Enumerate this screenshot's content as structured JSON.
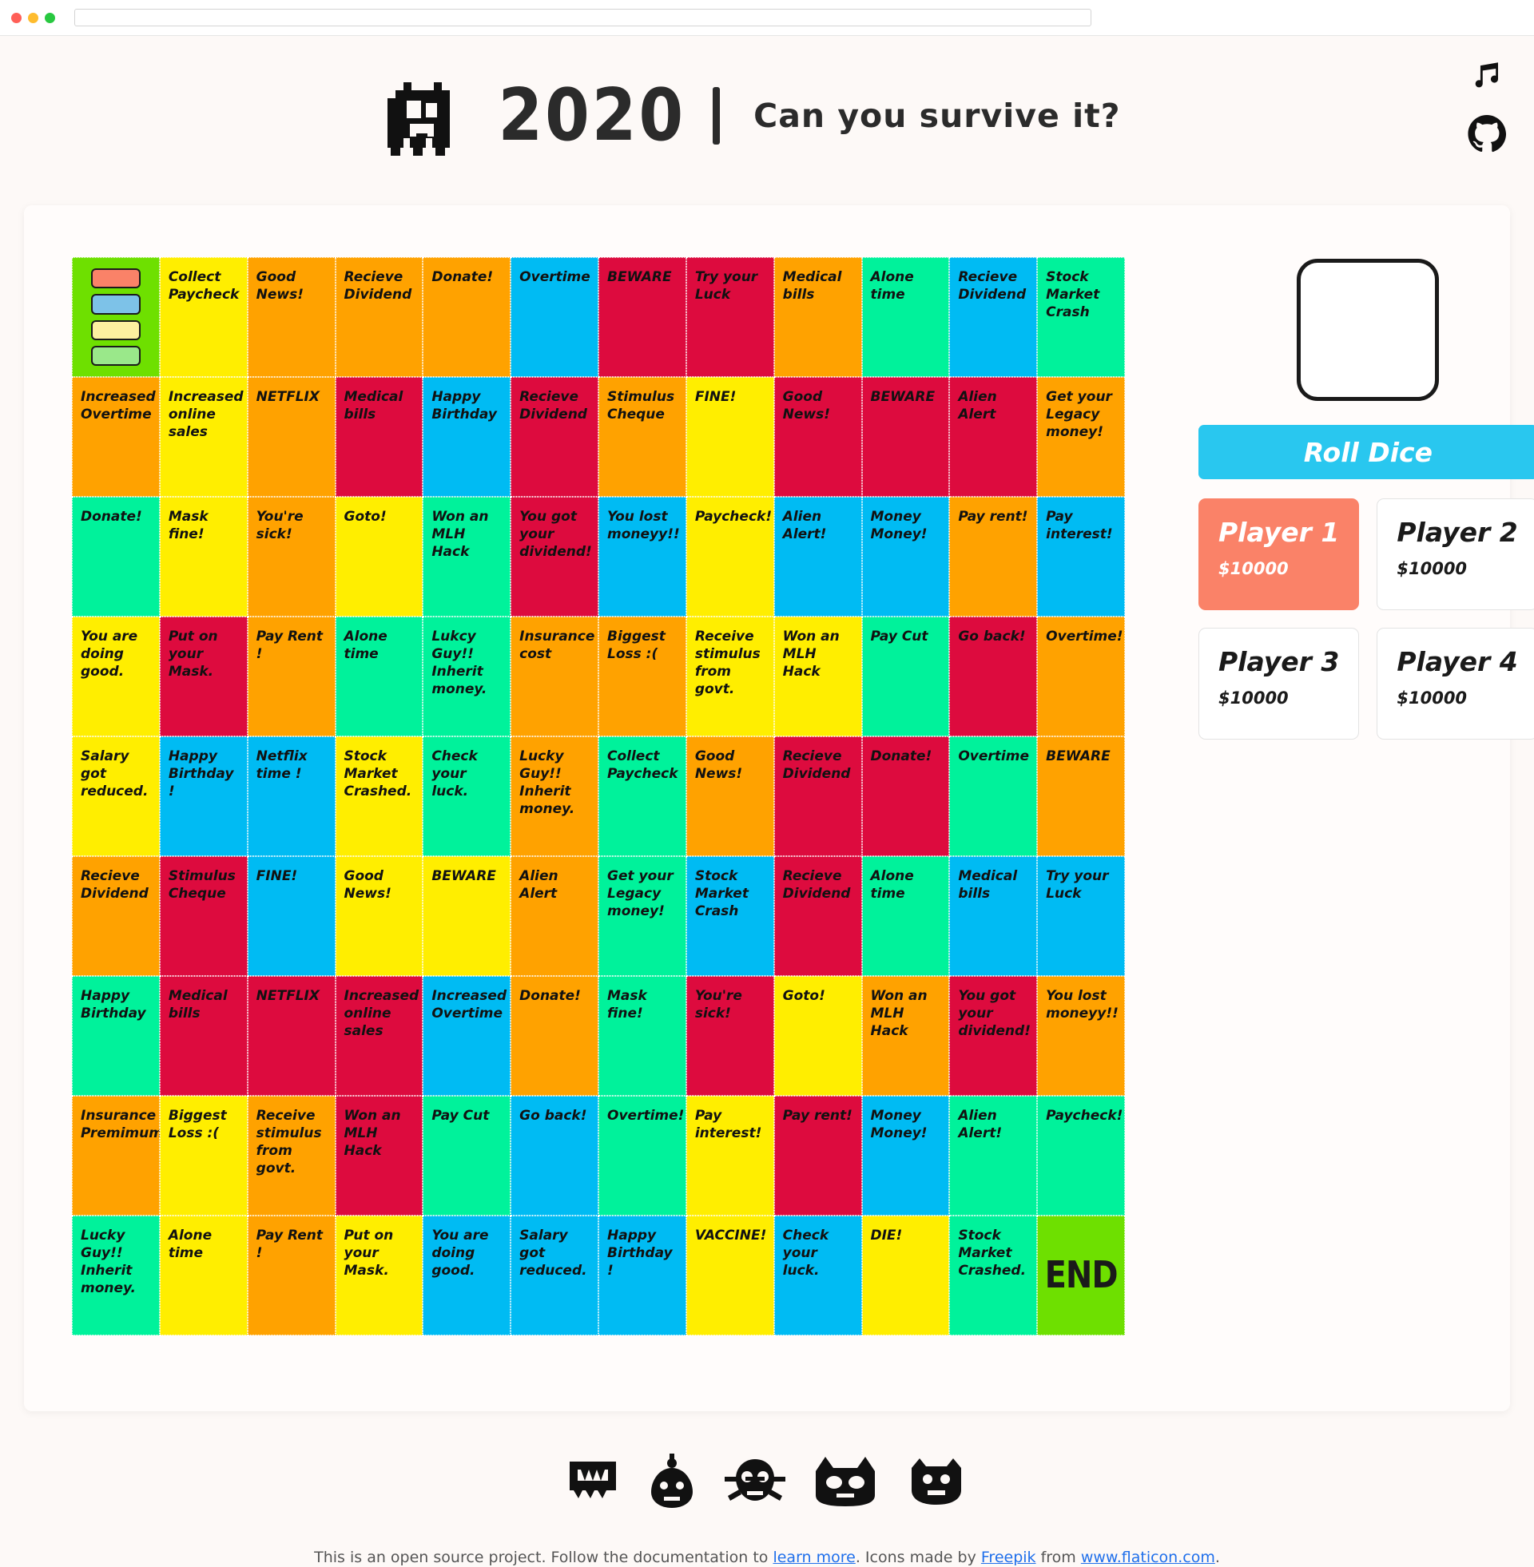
{
  "browser": {
    "url_value": "",
    "url_placeholder": ""
  },
  "header": {
    "year_title": "2020",
    "tagline": "Can you survive it?",
    "music_icon": "music-note-icon",
    "github_icon": "github-icon"
  },
  "board": {
    "start_cell": {
      "label": "",
      "color": "#6ee000",
      "tokens": [
        "#fa8268",
        "#7dc2e8",
        "#fdf0a0",
        "#9ae88a"
      ]
    },
    "end_cell": {
      "label": "END",
      "color": "#6ee000"
    },
    "cells": [
      {
        "text": "Collect Paycheck",
        "color": "yellow"
      },
      {
        "text": "Good News!",
        "color": "orange"
      },
      {
        "text": "Recieve Dividend",
        "color": "orange"
      },
      {
        "text": "Donate!",
        "color": "orange"
      },
      {
        "text": "Overtime",
        "color": "blue"
      },
      {
        "text": "BEWARE",
        "color": "red"
      },
      {
        "text": "Try your Luck",
        "color": "red"
      },
      {
        "text": "Medical bills",
        "color": "orange"
      },
      {
        "text": "Alone time",
        "color": "green"
      },
      {
        "text": "Recieve Dividend",
        "color": "blue"
      },
      {
        "text": "Stock Market Crash",
        "color": "green"
      },
      {
        "text": "Increased Overtime",
        "color": "orange"
      },
      {
        "text": "Increased online sales",
        "color": "yellow"
      },
      {
        "text": "NETFLIX",
        "color": "orange"
      },
      {
        "text": "Medical bills",
        "color": "red"
      },
      {
        "text": "Happy Birthday",
        "color": "blue"
      },
      {
        "text": "Recieve Dividend",
        "color": "red"
      },
      {
        "text": "Stimulus Cheque",
        "color": "orange"
      },
      {
        "text": "FINE!",
        "color": "yellow"
      },
      {
        "text": "Good News!",
        "color": "red"
      },
      {
        "text": "BEWARE",
        "color": "red"
      },
      {
        "text": "Alien Alert",
        "color": "red"
      },
      {
        "text": "Get your Legacy money!",
        "color": "orange"
      },
      {
        "text": "Donate!",
        "color": "green"
      },
      {
        "text": "Mask fine!",
        "color": "yellow"
      },
      {
        "text": "You're sick!",
        "color": "orange"
      },
      {
        "text": "Goto!",
        "color": "yellow"
      },
      {
        "text": "Won an MLH Hack",
        "color": "green"
      },
      {
        "text": "You got your dividend!",
        "color": "red"
      },
      {
        "text": "You lost moneyy!!",
        "color": "blue"
      },
      {
        "text": "Paycheck!",
        "color": "yellow"
      },
      {
        "text": "Alien Alert!",
        "color": "blue"
      },
      {
        "text": "Money Money!",
        "color": "blue"
      },
      {
        "text": "Pay rent!",
        "color": "orange"
      },
      {
        "text": "Pay interest!",
        "color": "blue"
      },
      {
        "text": "You are doing good.",
        "color": "yellow"
      },
      {
        "text": "Put on your Mask.",
        "color": "red"
      },
      {
        "text": "Pay Rent !",
        "color": "orange"
      },
      {
        "text": "Alone time",
        "color": "green"
      },
      {
        "text": "Lukcy Guy!! Inherit money.",
        "color": "green"
      },
      {
        "text": "Insurance cost",
        "color": "orange"
      },
      {
        "text": "Biggest Loss :(",
        "color": "orange"
      },
      {
        "text": "Receive stimulus from govt.",
        "color": "yellow"
      },
      {
        "text": "Won an MLH Hack",
        "color": "yellow"
      },
      {
        "text": "Pay Cut",
        "color": "green"
      },
      {
        "text": "Go back!",
        "color": "red"
      },
      {
        "text": "Overtime!",
        "color": "orange"
      },
      {
        "text": "Salary got reduced.",
        "color": "yellow"
      },
      {
        "text": "Happy Birthday !",
        "color": "blue"
      },
      {
        "text": "Netflix time !",
        "color": "blue"
      },
      {
        "text": "Stock Market Crashed.",
        "color": "yellow"
      },
      {
        "text": "Check your luck.",
        "color": "green"
      },
      {
        "text": "Lucky Guy!! Inherit money.",
        "color": "orange"
      },
      {
        "text": "Collect Paycheck",
        "color": "green"
      },
      {
        "text": "Good News!",
        "color": "orange"
      },
      {
        "text": "Recieve Dividend",
        "color": "red"
      },
      {
        "text": "Donate!",
        "color": "red"
      },
      {
        "text": "Overtime",
        "color": "green"
      },
      {
        "text": "BEWARE",
        "color": "orange"
      },
      {
        "text": "Recieve Dividend",
        "color": "orange"
      },
      {
        "text": "Stimulus Cheque",
        "color": "red"
      },
      {
        "text": "FINE!",
        "color": "blue"
      },
      {
        "text": "Good News!",
        "color": "yellow"
      },
      {
        "text": "BEWARE",
        "color": "yellow"
      },
      {
        "text": "Alien Alert",
        "color": "orange"
      },
      {
        "text": "Get your Legacy money!",
        "color": "green"
      },
      {
        "text": "Stock Market Crash",
        "color": "blue"
      },
      {
        "text": "Recieve Dividend",
        "color": "red"
      },
      {
        "text": "Alone time",
        "color": "green"
      },
      {
        "text": "Medical bills",
        "color": "blue"
      },
      {
        "text": "Try your Luck",
        "color": "blue"
      },
      {
        "text": "Happy Birthday",
        "color": "green"
      },
      {
        "text": "Medical bills",
        "color": "red"
      },
      {
        "text": "NETFLIX",
        "color": "red"
      },
      {
        "text": "Increased online sales",
        "color": "red"
      },
      {
        "text": "Increased Overtime",
        "color": "blue"
      },
      {
        "text": "Donate!",
        "color": "orange"
      },
      {
        "text": "Mask fine!",
        "color": "green"
      },
      {
        "text": "You're sick!",
        "color": "red"
      },
      {
        "text": "Goto!",
        "color": "yellow"
      },
      {
        "text": "Won an MLH Hack",
        "color": "orange"
      },
      {
        "text": "You got your dividend!",
        "color": "red"
      },
      {
        "text": "You lost moneyy!!",
        "color": "orange"
      },
      {
        "text": "Insurance Premimum",
        "color": "orange"
      },
      {
        "text": "Biggest Loss :(",
        "color": "yellow"
      },
      {
        "text": "Receive stimulus from govt.",
        "color": "orange"
      },
      {
        "text": "Won an MLH Hack",
        "color": "red"
      },
      {
        "text": "Pay Cut",
        "color": "green"
      },
      {
        "text": "Go back!",
        "color": "blue"
      },
      {
        "text": "Overtime!",
        "color": "green"
      },
      {
        "text": "Pay interest!",
        "color": "yellow"
      },
      {
        "text": "Pay rent!",
        "color": "red"
      },
      {
        "text": "Money Money!",
        "color": "blue"
      },
      {
        "text": "Alien Alert!",
        "color": "green"
      },
      {
        "text": "Paycheck!",
        "color": "green"
      },
      {
        "text": "Lucky Guy!! Inherit money.",
        "color": "green"
      },
      {
        "text": "Alone time",
        "color": "yellow"
      },
      {
        "text": "Pay Rent !",
        "color": "orange"
      },
      {
        "text": "Put on your Mask.",
        "color": "yellow"
      },
      {
        "text": "You are doing good.",
        "color": "blue"
      },
      {
        "text": "Salary got reduced.",
        "color": "blue"
      },
      {
        "text": "Happy Birthday !",
        "color": "blue"
      },
      {
        "text": "VACCINE!",
        "color": "yellow"
      },
      {
        "text": "Check your luck.",
        "color": "blue"
      },
      {
        "text": "DIE!",
        "color": "yellow"
      },
      {
        "text": "Stock Market Crashed.",
        "color": "green"
      }
    ]
  },
  "panel": {
    "dice_value": "",
    "roll_label": "Roll Dice",
    "players": [
      {
        "name": "Player 1",
        "money": "$10000",
        "active": true,
        "color": "#fa8268"
      },
      {
        "name": "Player 2",
        "money": "$10000",
        "active": false,
        "color": "#ffffff"
      },
      {
        "name": "Player 3",
        "money": "$10000",
        "active": false,
        "color": "#ffffff"
      },
      {
        "name": "Player 4",
        "money": "$10000",
        "active": false,
        "color": "#ffffff"
      }
    ]
  },
  "footer": {
    "text_1": "This is an open source project. Follow the documentation to ",
    "link_1": "learn more",
    "text_2": ". Icons made by ",
    "link_2": "Freepik",
    "text_3": " from ",
    "link_3": "www.flaticon.com",
    "text_4": "."
  }
}
